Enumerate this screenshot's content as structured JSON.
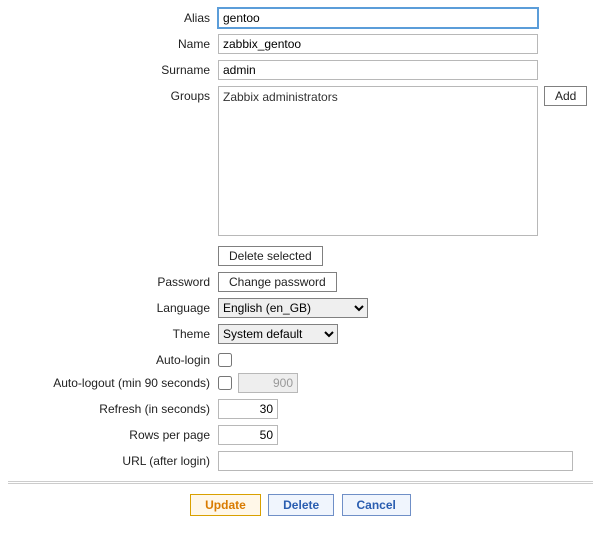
{
  "labels": {
    "alias": "Alias",
    "name": "Name",
    "surname": "Surname",
    "groups": "Groups",
    "password": "Password",
    "language": "Language",
    "theme": "Theme",
    "auto_login": "Auto-login",
    "auto_logout": "Auto-logout (min 90 seconds)",
    "refresh": "Refresh (in seconds)",
    "rows": "Rows per page",
    "url": "URL (after login)"
  },
  "values": {
    "alias": "gentoo",
    "name": "zabbix_gentoo",
    "surname": "admin",
    "auto_login_checked": false,
    "auto_logout_checked": false,
    "auto_logout_value": "900",
    "refresh": "30",
    "rows": "50",
    "url": ""
  },
  "groups": {
    "items": [
      "Zabbix administrators"
    ],
    "add_label": "Add",
    "delete_label": "Delete selected"
  },
  "password_button": "Change password",
  "language_options": [
    "English (en_GB)"
  ],
  "language_selected": "English (en_GB)",
  "theme_options": [
    "System default"
  ],
  "theme_selected": "System default",
  "footer": {
    "update": "Update",
    "delete": "Delete",
    "cancel": "Cancel"
  }
}
